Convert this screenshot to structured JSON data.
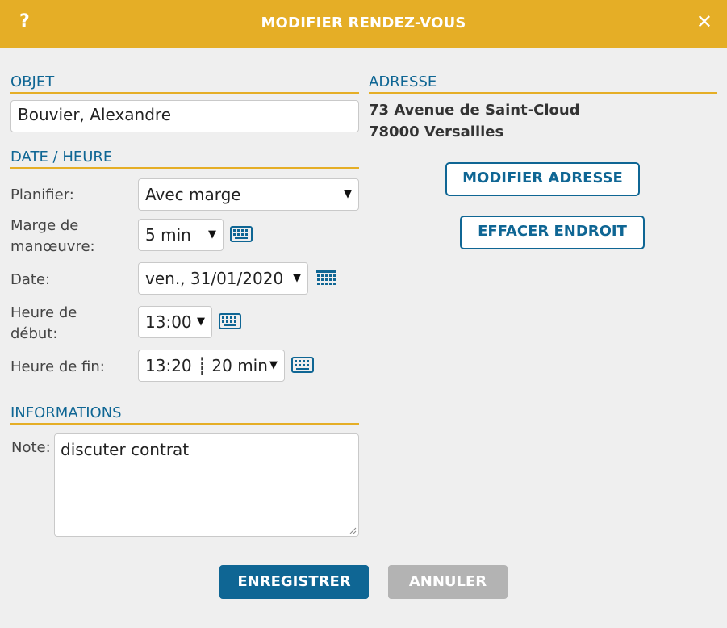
{
  "dialog": {
    "title": "MODIFIER RENDEZ-VOUS",
    "help_label": "?",
    "close_label": "✕",
    "accent_color": "#e5ae26",
    "primary_color": "#0f6694"
  },
  "objet": {
    "section_title": "OBJET",
    "value": "Bouvier, Alexandre"
  },
  "date_heure": {
    "section_title": "DATE / HEURE",
    "planifier_label": "Planifier:",
    "planifier_value": "Avec marge",
    "marge_label_line1": "Marge de",
    "marge_label_line2": "manœuvre:",
    "marge_value": "5 min",
    "date_label": "Date:",
    "date_value": "ven., 31/01/2020",
    "debut_label_line1": "Heure de",
    "debut_label_line2": "début:",
    "debut_value": "13:00",
    "fin_label": "Heure de fin:",
    "fin_value": "13:20 ┊ 20 min"
  },
  "informations": {
    "section_title": "INFORMATIONS",
    "note_label": "Note:",
    "note_value": "discuter contrat"
  },
  "adresse": {
    "section_title": "ADRESSE",
    "line1": "73 Avenue de Saint-Cloud",
    "line2": "78000 Versailles",
    "modify_label": "MODIFIER ADRESSE",
    "clear_label": "EFFACER ENDROIT"
  },
  "footer": {
    "save_label": "ENREGISTRER",
    "cancel_label": "ANNULER"
  },
  "icons": {
    "keyboard": "keyboard-icon",
    "calendar": "calendar-icon",
    "dropdown": "chevron-down-icon"
  }
}
